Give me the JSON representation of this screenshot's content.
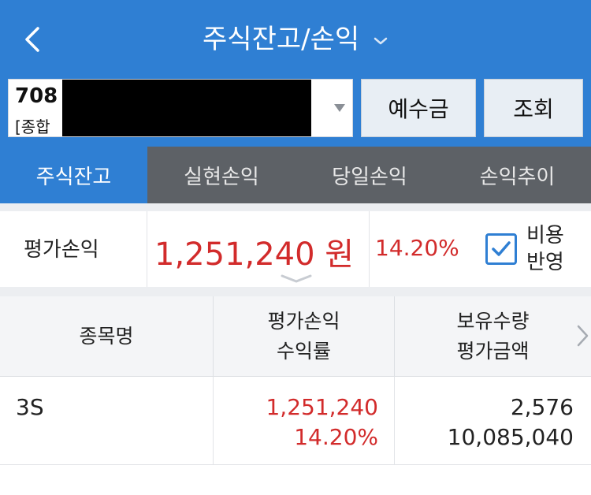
{
  "header": {
    "title": "주식잔고/손익"
  },
  "account": {
    "number": "708",
    "type": "[종합"
  },
  "buttons": {
    "deposit": "예수금",
    "query": "조회"
  },
  "tabs": [
    {
      "label": "주식잔고",
      "active": true
    },
    {
      "label": "실현손익",
      "active": false
    },
    {
      "label": "당일손익",
      "active": false
    },
    {
      "label": "손익추이",
      "active": false
    }
  ],
  "summary": {
    "label": "평가손익",
    "amount": "1,251,240 원",
    "rate": "14.20%",
    "include_cost_line1": "비용",
    "include_cost_line2": "반영",
    "include_cost_checked": true
  },
  "table": {
    "headers": {
      "col1": "종목명",
      "col2_line1": "평가손익",
      "col2_line2": "수익률",
      "col3_line1": "보유수량",
      "col3_line2": "평가금액"
    },
    "rows": [
      {
        "name": "3S",
        "pl": "1,251,240",
        "rate": "14.20%",
        "qty": "2,576",
        "value": "10,085,040"
      }
    ]
  },
  "colors": {
    "brand_blue": "#2f7fd3",
    "profit_red": "#d22b2b",
    "tab_grey": "#5d6166"
  },
  "icons": {
    "back": "chevron-left-icon",
    "title_dropdown": "chevron-down-icon",
    "account_dropdown": "triangle-down-icon",
    "expand": "chevron-down-icon",
    "next_columns": "chevron-right-icon",
    "checkbox": "check-icon"
  }
}
